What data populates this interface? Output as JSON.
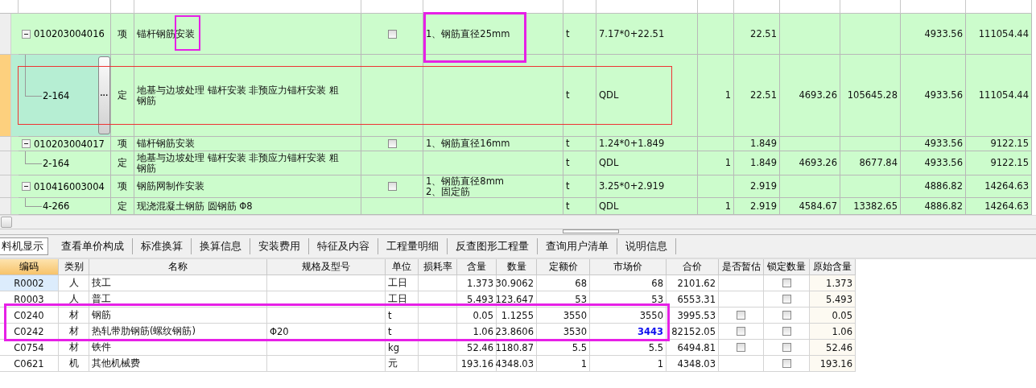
{
  "bill_grid": {
    "rows": [
      {
        "code": "010203004016",
        "type": "项",
        "name": "锚杆钢筋安装",
        "checkbox": {
          "checked": false
        },
        "features": "1、钢筋直径25mm",
        "unit": "t",
        "expression": "7.17*0+22.51",
        "column_10": "22.51",
        "column_13": "4933.56",
        "column_14": "111054.44",
        "expanded": true,
        "selected": false,
        "children": [
          {
            "code": "2-164",
            "type": "定",
            "name": "地基与边坡处理 锚杆安装 非预应力锚杆安装 粗钢筋",
            "unit": "t",
            "expression": "QDL",
            "column_9": "1",
            "column_10": "22.51",
            "column_11": "4693.26",
            "column_12": "105645.28",
            "column_13": "4933.56",
            "column_14": "111054.44",
            "selected": true,
            "button": "···"
          }
        ]
      },
      {
        "code": "010203004017",
        "type": "项",
        "name": "锚杆钢筋安装",
        "checkbox": {
          "checked": false
        },
        "features": "1、钢筋直径16mm",
        "unit": "t",
        "expression": "1.24*0+1.849",
        "column_10": "1.849",
        "column_13": "4933.56",
        "column_14": "9122.15",
        "expanded": true,
        "selected": false,
        "children": [
          {
            "code": "2-164",
            "type": "定",
            "name": "地基与边坡处理 锚杆安装 非预应力锚杆安装 粗钢筋",
            "unit": "t",
            "expression": "QDL",
            "column_9": "1",
            "column_10": "1.849",
            "column_11": "4693.26",
            "column_12": "8677.84",
            "column_13": "4933.56",
            "column_14": "9122.15",
            "selected": false
          }
        ]
      },
      {
        "code": "010416003004",
        "type": "项",
        "name": "钢筋网制作安装",
        "checkbox": {
          "checked": false
        },
        "features": "1、钢筋直径8mm\n2、固定筋",
        "unit": "t",
        "expression": "3.25*0+2.919",
        "column_10": "2.919",
        "column_13": "4886.82",
        "column_14": "14264.63",
        "expanded": true,
        "selected": false,
        "children": [
          {
            "code": "4-266",
            "type": "定",
            "name": "现浇混凝土钢筋 圆钢筋 Φ8",
            "unit": "t",
            "expression": "QDL",
            "column_9": "1",
            "column_10": "2.919",
            "column_11": "4584.67",
            "column_12": "13382.65",
            "column_13": "4886.82",
            "column_14": "14264.63",
            "selected": false
          }
        ]
      }
    ]
  },
  "tabs": [
    {
      "label": "料机显示",
      "selected": true
    },
    {
      "label": "查看单价构成",
      "selected": false
    },
    {
      "label": "标准换算",
      "selected": false
    },
    {
      "label": "换算信息",
      "selected": false
    },
    {
      "label": "安装费用",
      "selected": false
    },
    {
      "label": "特征及内容",
      "selected": false
    },
    {
      "label": "工程量明细",
      "selected": false
    },
    {
      "label": "反查图形工程量",
      "selected": false
    },
    {
      "label": "查询用户清单",
      "selected": false
    },
    {
      "label": "说明信息",
      "selected": false
    }
  ],
  "material_grid": {
    "columns": [
      "编码",
      "类别",
      "名称",
      "规格及型号",
      "单位",
      "损耗率",
      "含量",
      "数量",
      "定额价",
      "市场价",
      "合价",
      "是否暂估",
      "锁定数量",
      "原始含量"
    ],
    "rows": [
      {
        "code": "R0002",
        "category": "人",
        "name": "技工",
        "unit": "工日",
        "content": "1.373",
        "quantity": "30.9062",
        "quota_price": "68",
        "market_price": "68",
        "market_price_modified": false,
        "total": "2101.62",
        "locked": false,
        "original_content": "1.373",
        "selected": true
      },
      {
        "code": "R0003",
        "category": "人",
        "name": "普工",
        "unit": "工日",
        "content": "5.493",
        "quantity": "123.647",
        "quota_price": "53",
        "market_price": "53",
        "market_price_modified": false,
        "total": "6553.31",
        "locked": false,
        "original_content": "5.493",
        "selected": false
      },
      {
        "code": "C0240",
        "category": "材",
        "name": "钢筋",
        "unit": "t",
        "content": "0.05",
        "quantity": "1.1255",
        "quota_price": "3550",
        "market_price": "3550",
        "market_price_modified": false,
        "total": "3995.53",
        "provisional": false,
        "locked": false,
        "original_content": "0.05",
        "selected": false
      },
      {
        "code": "C0242",
        "category": "材",
        "name": "热轧带肋钢筋(螺纹钢筋)",
        "spec": "Φ20",
        "unit": "t",
        "content": "1.06",
        "quantity": "23.8606",
        "quota_price": "3530",
        "market_price": "3443",
        "market_price_modified": true,
        "total": "82152.05",
        "provisional": false,
        "locked": false,
        "original_content": "1.06",
        "selected": false
      },
      {
        "code": "C0754",
        "category": "材",
        "name": "铁件",
        "unit": "kg",
        "content": "52.46",
        "quantity": "1180.87",
        "quota_price": "5.5",
        "market_price": "5.5",
        "market_price_modified": false,
        "total": "6494.81",
        "provisional": false,
        "locked": false,
        "original_content": "52.46",
        "selected": false
      },
      {
        "code": "C0621",
        "category": "机",
        "name": "其他机械费",
        "unit": "元",
        "content": "193.16",
        "quantity": "4348.03",
        "quota_price": "1",
        "market_price": "1",
        "market_price_modified": false,
        "total": "4348.03",
        "locked": false,
        "original_content": "193.16",
        "selected": false
      }
    ]
  },
  "annotations": [
    {
      "kind": "box",
      "color": "#e620e6"
    },
    {
      "kind": "box",
      "color": "#e620e6"
    },
    {
      "kind": "box",
      "color": "#ee3333"
    },
    {
      "kind": "box",
      "color": "#e620e6"
    }
  ]
}
